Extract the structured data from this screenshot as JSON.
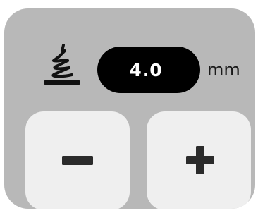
{
  "presser_foot": {
    "icon": "presser-foot-pressure-icon",
    "value": "4.0",
    "unit": "mm"
  },
  "controls": {
    "decrease_icon": "minus-icon",
    "increase_icon": "plus-icon"
  },
  "colors": {
    "panel_background": "#b8b8b8",
    "value_pill": "#000000",
    "value_text": "#ffffff",
    "button_background": "#efefef",
    "button_symbol": "#2b2b2b"
  }
}
